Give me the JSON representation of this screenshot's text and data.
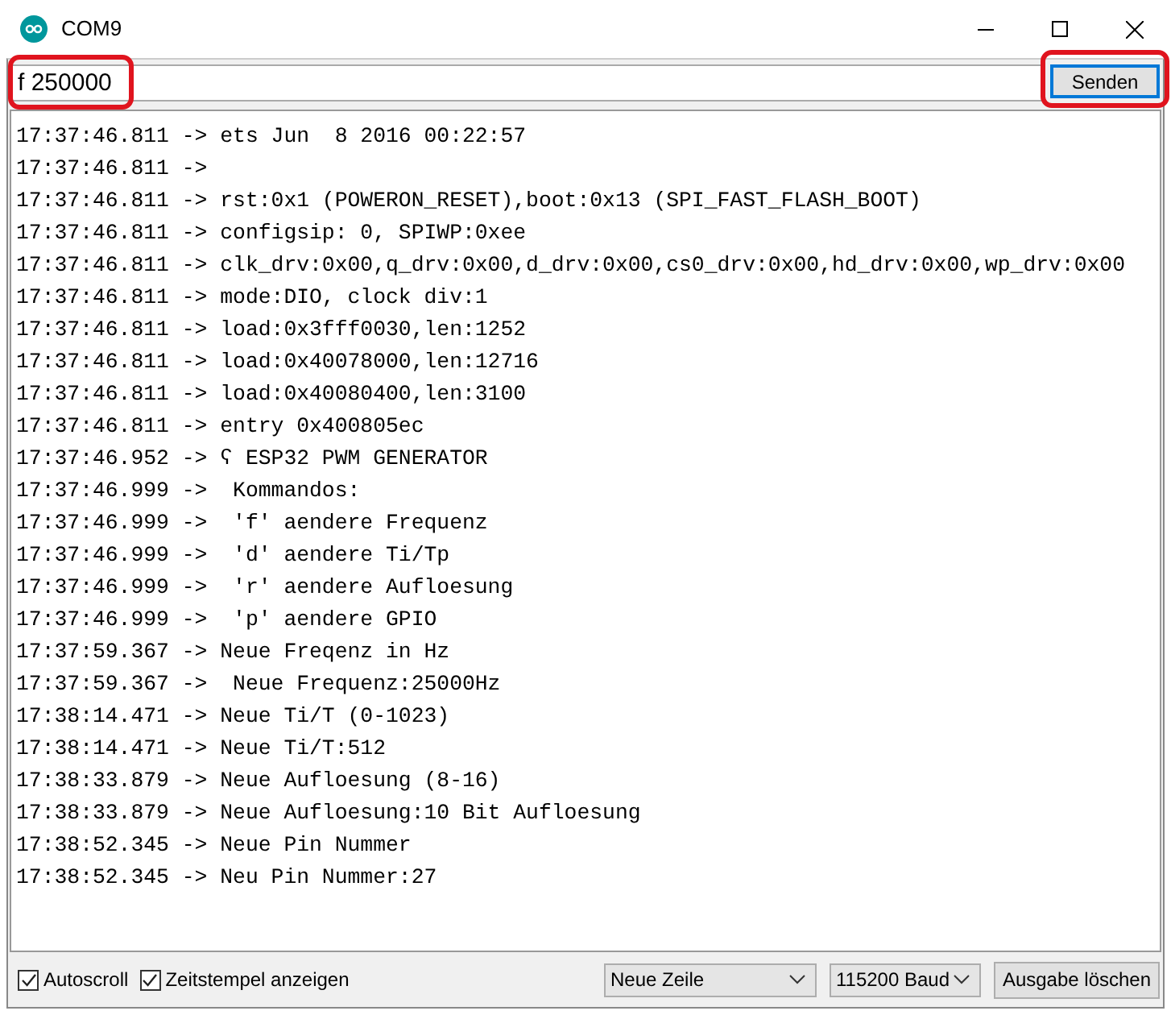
{
  "window": {
    "title": "COM9"
  },
  "input": {
    "value": "f 250000",
    "highlighted": true
  },
  "send_button": {
    "label": "Senden",
    "highlighted": true
  },
  "output_lines": [
    "17:37:46.811 -> ets Jun  8 2016 00:22:57",
    "17:37:46.811 -> ",
    "17:37:46.811 -> rst:0x1 (POWERON_RESET),boot:0x13 (SPI_FAST_FLASH_BOOT)",
    "17:37:46.811 -> configsip: 0, SPIWP:0xee",
    "17:37:46.811 -> clk_drv:0x00,q_drv:0x00,d_drv:0x00,cs0_drv:0x00,hd_drv:0x00,wp_drv:0x00",
    "17:37:46.811 -> mode:DIO, clock div:1",
    "17:37:46.811 -> load:0x3fff0030,len:1252",
    "17:37:46.811 -> load:0x40078000,len:12716",
    "17:37:46.811 -> load:0x40080400,len:3100",
    "17:37:46.811 -> entry 0x400805ec",
    "17:37:46.952 -> ʕ ESP32 PWM GENERATOR",
    "17:37:46.999 ->  Kommandos:",
    "17:37:46.999 ->  'f' aendere Frequenz",
    "17:37:46.999 ->  'd' aendere Ti/Tp",
    "17:37:46.999 ->  'r' aendere Aufloesung",
    "17:37:46.999 ->  'p' aendere GPIO",
    "17:37:59.367 -> Neue Freqenz in Hz",
    "17:37:59.367 ->  Neue Frequenz:25000Hz",
    "17:38:14.471 -> Neue Ti/T (0-1023)",
    "17:38:14.471 -> Neue Ti/T:512",
    "17:38:33.879 -> Neue Aufloesung (8-16)",
    "17:38:33.879 -> Neue Aufloesung:10 Bit Aufloesung",
    "17:38:52.345 -> Neue Pin Nummer",
    "17:38:52.345 -> Neu Pin Nummer:27"
  ],
  "checkboxes": [
    {
      "label": "Autoscroll",
      "checked": true
    },
    {
      "label": "Zeitstempel anzeigen",
      "checked": true
    }
  ],
  "line_ending_select": {
    "value": "Neue Zeile"
  },
  "baud_select": {
    "value": "115200 Baud"
  },
  "clear_button": {
    "label": "Ausgabe löschen"
  }
}
